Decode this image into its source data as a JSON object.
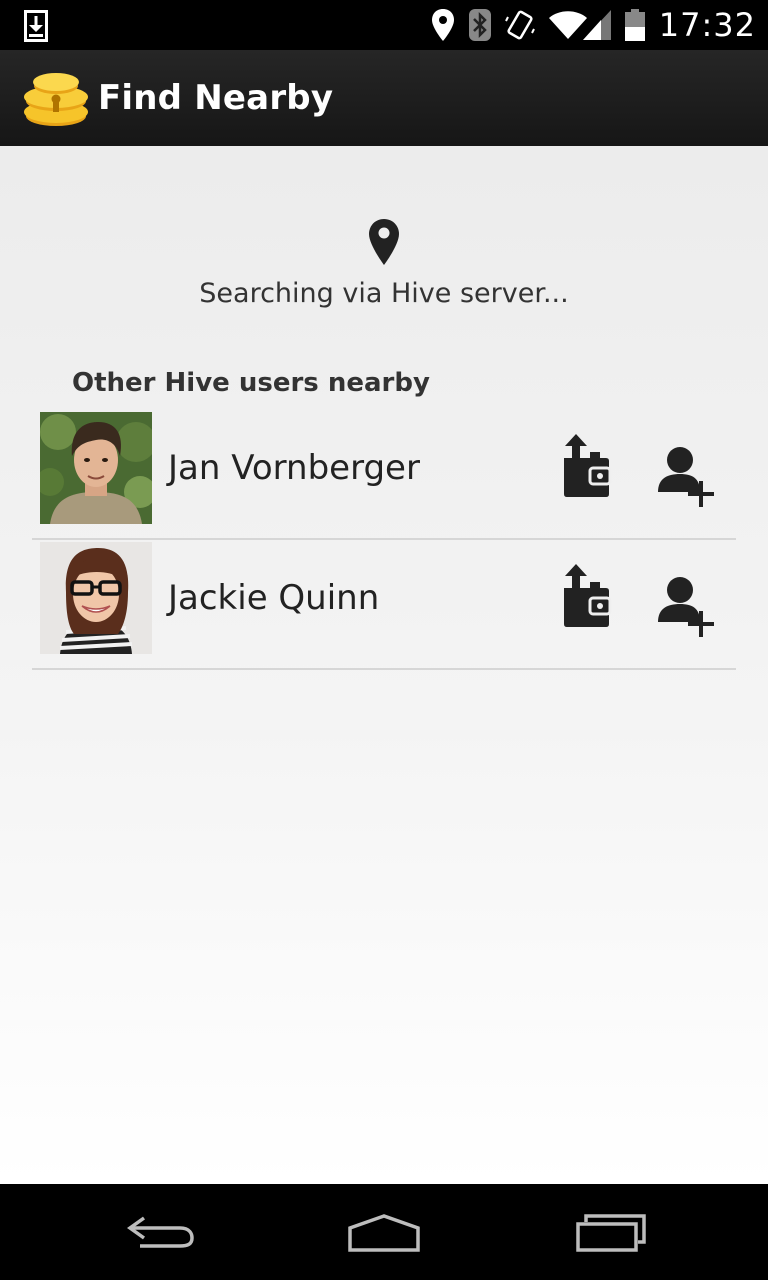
{
  "status_bar": {
    "time": "17:32",
    "icons": [
      "download-icon",
      "location-icon",
      "bluetooth-icon",
      "vibrate-icon",
      "wifi-icon",
      "signal-icon",
      "battery-icon"
    ]
  },
  "action_bar": {
    "title": "Find Nearby",
    "logo": "hive-logo"
  },
  "main": {
    "search_status": "Searching via Hive server...",
    "section_header": "Other Hive users nearby",
    "users": [
      {
        "name": "Jan Vornberger"
      },
      {
        "name": "Jackie Quinn"
      }
    ]
  },
  "nav_bar": {
    "buttons": [
      "back-icon",
      "home-icon",
      "recents-icon"
    ]
  },
  "colors": {
    "action_bar": "#1e1e1e",
    "content_bg": "#efefef",
    "text": "#333333",
    "logo_yellow": "#f7c325"
  }
}
